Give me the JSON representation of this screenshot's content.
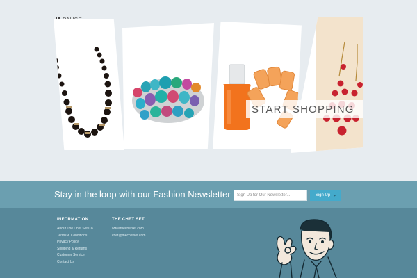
{
  "slideshow": {
    "pause_label": "PAUSE",
    "cta_label": "START SHOPPING"
  },
  "newsletter": {
    "title": "Stay in the loop with our Fashion Newsletter",
    "input_placeholder": "Sign Up for Our Newsletter...",
    "button_label": "Sign Up",
    "button_arrow": "▸"
  },
  "footer": {
    "information": {
      "heading": "INFORMATION",
      "links": [
        "About The Chet Set Co.",
        "Terms & Conditions",
        "Privacy Policy",
        "Shipping & Returns",
        "Customer Service",
        "Contact Us"
      ]
    },
    "chet_set": {
      "heading": "THE CHET SET",
      "links": [
        "www.thechetset.com",
        "chet@thechetset.com"
      ]
    }
  },
  "colors": {
    "hero_bg": "#e7ecf0",
    "newsletter_bg": "#6b9fb0",
    "footer_bg": "#57889a",
    "button_bg": "#44aacb"
  }
}
